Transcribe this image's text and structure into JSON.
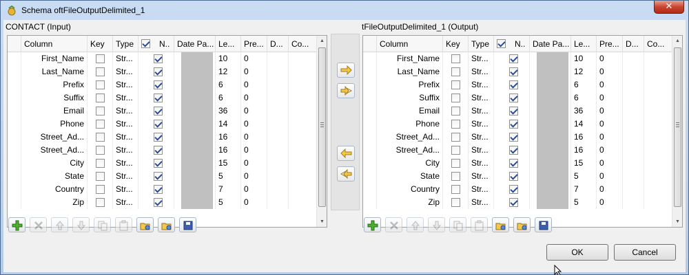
{
  "window": {
    "title": "Schema oftFileOutputDelimited_1"
  },
  "left": {
    "label": "CONTACT (Input)",
    "columns": [
      "Column",
      "Key",
      "Type",
      "N..",
      "Date Pa...",
      "Le...",
      "Pre...",
      "D...",
      "Co..."
    ]
  },
  "right": {
    "label": "tFileOutputDelimited_1 (Output)",
    "columns": [
      "Column",
      "Key",
      "Type",
      "N..",
      "Date Pa...",
      "Le...",
      "Pre...",
      "D...",
      "Co..."
    ]
  },
  "rows": [
    {
      "name": "First_Name",
      "type": "Str...",
      "length": "10",
      "precision": "0"
    },
    {
      "name": "Last_Name",
      "type": "Str...",
      "length": "12",
      "precision": "0"
    },
    {
      "name": "Prefix",
      "type": "Str...",
      "length": "6",
      "precision": "0"
    },
    {
      "name": "Suffix",
      "type": "Str...",
      "length": "6",
      "precision": "0"
    },
    {
      "name": "Email",
      "type": "Str...",
      "length": "36",
      "precision": "0"
    },
    {
      "name": "Phone",
      "type": "Str...",
      "length": "14",
      "precision": "0"
    },
    {
      "name": "Street_Ad...",
      "type": "Str...",
      "length": "16",
      "precision": "0"
    },
    {
      "name": "Street_Ad...",
      "type": "Str...",
      "length": "16",
      "precision": "0"
    },
    {
      "name": "City",
      "type": "Str...",
      "length": "15",
      "precision": "0"
    },
    {
      "name": "State",
      "type": "Str...",
      "length": "5",
      "precision": "0"
    },
    {
      "name": "Country",
      "type": "Str...",
      "length": "7",
      "precision": "0"
    },
    {
      "name": "Zip",
      "type": "Str...",
      "length": "5",
      "precision": "0"
    }
  ],
  "buttons": {
    "ok": "OK",
    "cancel": "Cancel"
  },
  "colors": {
    "accent": "#2a4a9c",
    "datepattern_bg": "#c0c0c0"
  }
}
